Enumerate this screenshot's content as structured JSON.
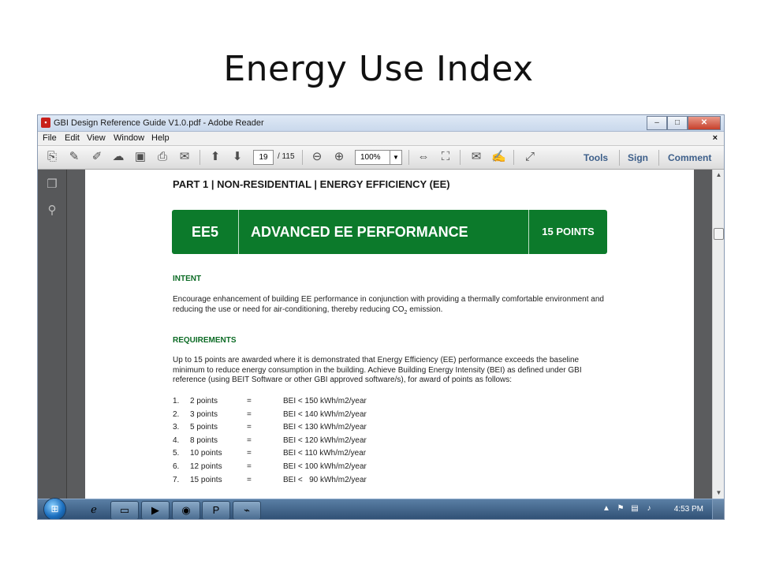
{
  "slide": {
    "title": "Energy Use Index"
  },
  "window": {
    "title": "GBI Design Reference Guide V1.0.pdf - Adobe Reader",
    "controls": [
      "–",
      "□",
      "✕"
    ]
  },
  "menu": {
    "items": [
      "File",
      "Edit",
      "View",
      "Window",
      "Help"
    ],
    "close_glyph": "×"
  },
  "toolbar": {
    "page_current": "19",
    "page_total": "/ 115",
    "zoom": "100%",
    "right_buttons": [
      "Tools",
      "Sign",
      "Comment"
    ]
  },
  "document": {
    "heading": "PART 1 | NON-RESIDENTIAL | ENERGY EFFICIENCY (EE)",
    "banner": {
      "code": "EE5",
      "title": "ADVANCED EE PERFORMANCE",
      "points": "15 POINTS"
    },
    "intent_heading": "INTENT",
    "intent_text_1": "Encourage enhancement of building EE performance in conjunction with providing a thermally comfortable environment and reducing the use or need for air-conditioning, thereby reducing CO",
    "intent_sub": "2",
    "intent_text_2": " emission.",
    "requirements_heading": "REQUIREMENTS",
    "requirements_text": "Up to 15 points are awarded where it is demonstrated that Energy Efficiency (EE) performance exceeds the baseline minimum to reduce energy consumption in the building. Achieve Building Energy Intensity (BEI) as defined under GBI reference (using BEIT Software or other GBI approved software/s), for award of points as follows:",
    "points_list": [
      {
        "num": "1.",
        "points": "2 points",
        "eq": "=",
        "bei": "BEI < 150 kWh/m2/year"
      },
      {
        "num": "2.",
        "points": "3 points",
        "eq": "=",
        "bei": "BEI < 140 kWh/m2/year"
      },
      {
        "num": "3.",
        "points": "5 points",
        "eq": "=",
        "bei": "BEI < 130 kWh/m2/year"
      },
      {
        "num": "4.",
        "points": "8 points",
        "eq": "=",
        "bei": "BEI < 120 kWh/m2/year"
      },
      {
        "num": "5.",
        "points": "10 points",
        "eq": "=",
        "bei": "BEI < 110 kWh/m2/year"
      },
      {
        "num": "6.",
        "points": "12 points",
        "eq": "=",
        "bei": "BEI < 100 kWh/m2/year"
      },
      {
        "num": "7.",
        "points": "15 points",
        "eq": "=",
        "bei": "BEI <   90 kWh/m2/year"
      }
    ]
  },
  "taskbar": {
    "clock": "4:53 PM"
  }
}
